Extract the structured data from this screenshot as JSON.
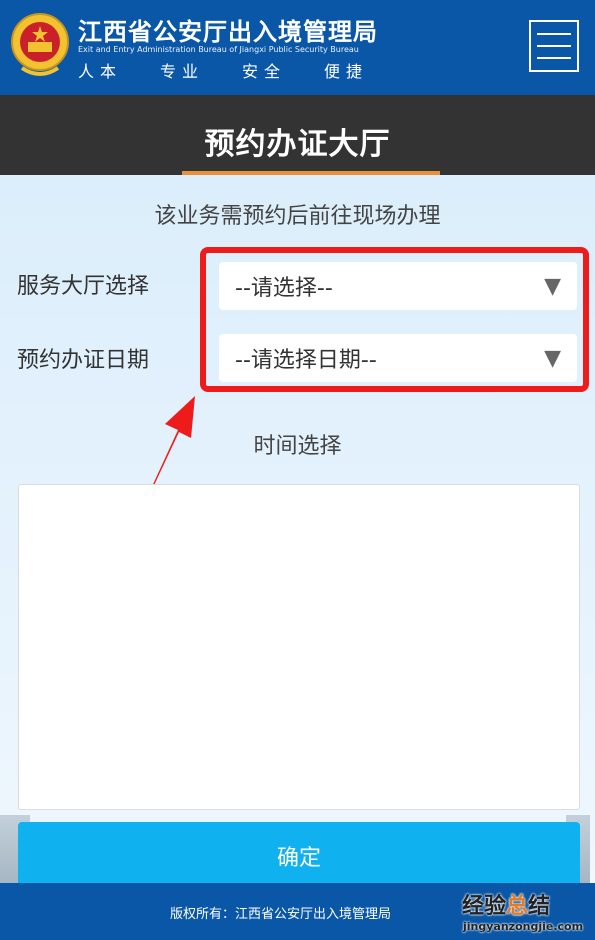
{
  "header": {
    "org_name": "江西省公安厅出入境管理局",
    "org_name_en": "Exit and Entry Administration Bureau of Jiangxi Public Security Bureau",
    "motto": [
      "人本",
      "专业",
      "安全",
      "便捷"
    ],
    "menu_icon": "hamburger-menu-icon",
    "emblem_icon": "police-emblem-icon"
  },
  "page": {
    "title": "预约办证大厅",
    "notice": "该业务需预约后前往现场办理"
  },
  "form": {
    "hall": {
      "label": "服务大厅选择",
      "value": "--请选择--"
    },
    "date": {
      "label": "预约办证日期",
      "value": "--请选择日期--"
    },
    "time_label": "时间选择",
    "confirm_label": "确定"
  },
  "footer": {
    "copyright": "版权所有：江西省公安厅出入境管理局"
  },
  "watermark": {
    "text_prefix": "经验",
    "text_highlight": "总",
    "text_suffix": "结",
    "url": "jingyanzongjie.com"
  },
  "colors": {
    "header_blue": "#0a57a8",
    "title_bar": "#333333",
    "accent_orange": "#e8913a",
    "annotation_red": "#ee1b1b",
    "confirm_button": "#0fb2ee"
  }
}
